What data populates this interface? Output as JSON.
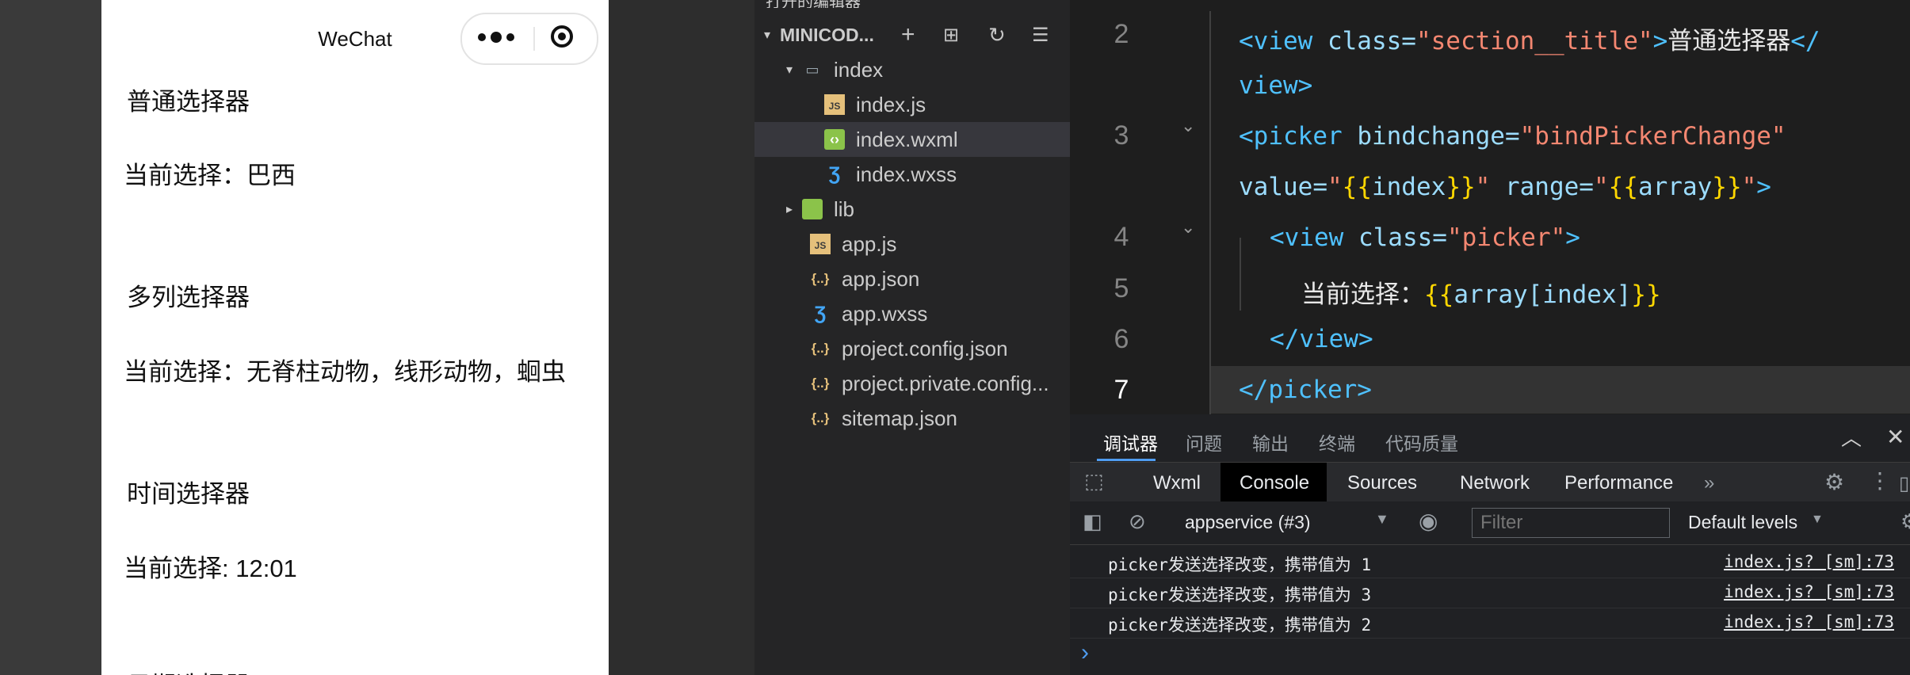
{
  "simulator": {
    "nav_title": "WeChat",
    "sections": [
      {
        "title": "普通选择器",
        "current": "当前选择：巴西"
      },
      {
        "title": "多列选择器",
        "current": "当前选择：无脊柱动物，线形动物，蛔虫"
      },
      {
        "title": "时间选择器",
        "current": "当前选择: 12:01"
      },
      {
        "title": "日期选择器"
      }
    ]
  },
  "explorer": {
    "header_partial": "打开的编辑器",
    "project": {
      "label": "MINICOD..."
    },
    "items": [
      {
        "label": "index",
        "type": "folder-open"
      },
      {
        "label": "index.js",
        "type": "js"
      },
      {
        "label": "index.wxml",
        "type": "wxml",
        "selected": true
      },
      {
        "label": "index.wxss",
        "type": "wxss"
      },
      {
        "label": "lib",
        "type": "folder"
      },
      {
        "label": "app.js",
        "type": "js"
      },
      {
        "label": "app.json",
        "type": "json"
      },
      {
        "label": "app.wxss",
        "type": "wxss"
      },
      {
        "label": "project.config.json",
        "type": "json"
      },
      {
        "label": "project.private.config...",
        "type": "json"
      },
      {
        "label": "sitemap.json",
        "type": "json"
      }
    ]
  },
  "editor": {
    "line_numbers": [
      "2",
      "3",
      "4",
      "5",
      "6",
      "7"
    ],
    "current_line": "7",
    "code": {
      "l2a_tag": "<view ",
      "l2a_attr": "class=",
      "l2a_val": "\"section__title\"",
      "l2a_close": ">",
      "l2a_text": "普通选择器",
      "l2a_end": "</",
      "l2b_end": "view>",
      "l3a_tag": "<picker ",
      "l3a_attr": "bindchange=",
      "l3a_val": "\"bindPickerChange\"",
      "l3b_attr1": "value=",
      "l3b_q1": "\"",
      "l3b_b1": "{{",
      "l3b_v1": "index",
      "l3b_b2": "}}",
      "l3b_q2": "\" ",
      "l3b_attr2": "range=",
      "l3b_q3": "\"",
      "l3b_b3": "{{",
      "l3b_v2": "array",
      "l3b_b4": "}}",
      "l3b_q4": "\"",
      "l3b_close": ">",
      "l4_tag": "<view ",
      "l4_attr": "class=",
      "l4_val": "\"picker\"",
      "l4_close": ">",
      "l5_text": "当前选择：",
      "l5_b1": "{{",
      "l5_expr": "array[index]",
      "l5_b2": "}}",
      "l6_tag": "</view>",
      "l7_tag": "</picker>"
    }
  },
  "devtools": {
    "top_tabs": [
      "调试器",
      "问题",
      "输出",
      "终端",
      "代码质量"
    ],
    "active_top_tab": "调试器",
    "panels": [
      "Wxml",
      "Console",
      "Sources",
      "Network",
      "Performance"
    ],
    "active_panel": "Console",
    "more": "»",
    "context": "appservice (#3)",
    "filter_placeholder": "Filter",
    "levels": "Default levels",
    "logs": [
      {
        "message": "picker发送选择改变，携带值为 1",
        "source": "index.js? [sm]:73"
      },
      {
        "message": "picker发送选择改变，携带值为 3",
        "source": "index.js? [sm]:73"
      },
      {
        "message": "picker发送选择改变，携带值为 2",
        "source": "index.js? [sm]:73"
      }
    ],
    "prompt": "›"
  }
}
